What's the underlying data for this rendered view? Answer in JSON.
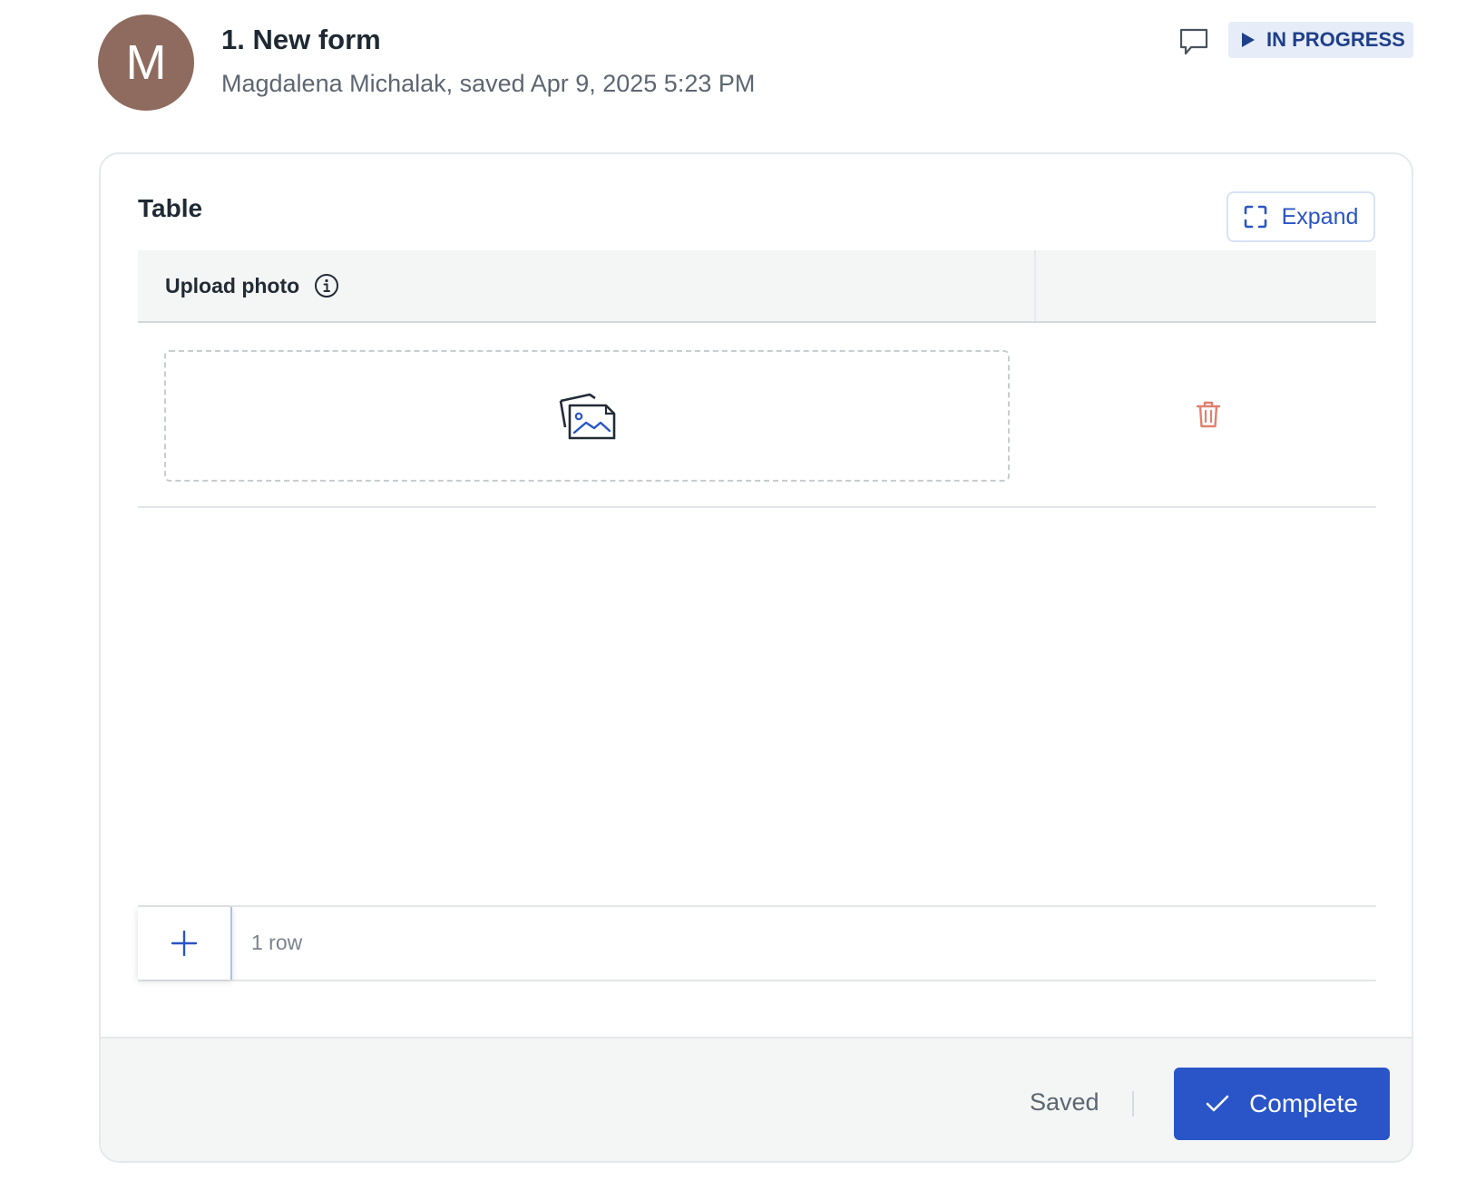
{
  "header": {
    "avatar_initial": "M",
    "avatar_color": "#8e6b5e",
    "title": "1. New form",
    "subtitle": "Magdalena Michalak, saved Apr 9, 2025 5:23 PM",
    "comment_icon": "comment-icon",
    "status": {
      "label": "IN PROGRESS",
      "icon": "play-icon",
      "color": "#1f3f8a",
      "background": "#e6edf8"
    }
  },
  "table_section": {
    "title": "Table",
    "expand_label": "Expand",
    "expand_icon": "expand-icon",
    "columns": [
      {
        "label": "Upload photo",
        "icon": "info-icon"
      },
      {
        "label": ""
      }
    ],
    "rows": [
      {
        "upload_icon": "image-upload-icon",
        "delete_icon": "trash-icon"
      }
    ],
    "add_row_icon": "plus-icon",
    "row_count": "1 row"
  },
  "footer": {
    "saved_label": "Saved",
    "complete_label": "Complete",
    "complete_icon": "check-icon",
    "accent_color": "#2a55c9"
  }
}
